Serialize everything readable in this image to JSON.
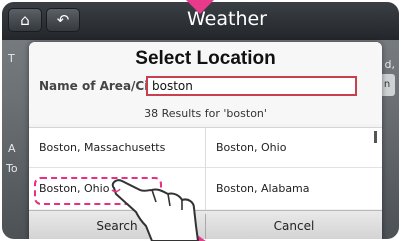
{
  "app_title": "Weather",
  "topbar": {
    "home_icon": "home-icon",
    "back_icon": "back-arrow-icon"
  },
  "background": {
    "left_letters": [
      "T",
      "A",
      "To"
    ],
    "right_letters": [
      "d,",
      "n"
    ]
  },
  "dialog": {
    "title": "Select Location",
    "field_label": "Name of Area/City",
    "field_value": "boston",
    "results_text": "38 Results for 'boston'",
    "results": [
      {
        "left": "Boston, Massachusetts",
        "right": "Boston, Ohio"
      },
      {
        "left": "Boston, Ohio",
        "right": "Boston, Alabama"
      }
    ],
    "search_label": "Search",
    "cancel_label": "Cancel"
  },
  "colors": {
    "highlight": "#e8307e",
    "input_border": "#c8404f",
    "arrow": "#e83a8a"
  }
}
